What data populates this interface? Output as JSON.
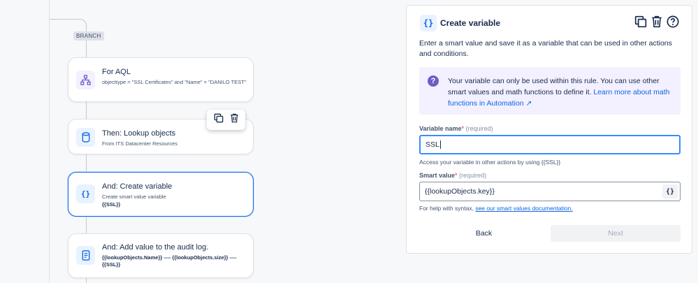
{
  "branch": {
    "tag": "BRANCH"
  },
  "cards": [
    {
      "title": "For AQL",
      "subtitle": "objecttype = \"SSL Certificates\" and \"Name\" = \"DANILO TEST\"",
      "icon": "hierarchy-icon"
    },
    {
      "title": "Then: Lookup objects",
      "subtitle": "From ITS Datacenter Resources",
      "icon": "database-icon"
    },
    {
      "title": "And: Create variable",
      "subtitle": "Create smart value variable",
      "subtitle2": "{{SSL}}",
      "icon": "braces-icon"
    },
    {
      "title": "And: Add value to the audit log.",
      "subtitle": "{{lookupObjects.Name}} ---- {{lookupObjects.size}} ---- {{SSL}}",
      "icon": "document-icon"
    }
  ],
  "panel": {
    "icon_text": "{}",
    "title": "Create variable",
    "description": "Enter a smart value and save it as a variable that can be used in other actions and conditions.",
    "info": {
      "text": "Your variable can only be used within this rule. You can use other smart values and math functions to define it. ",
      "link": "Learn more about math functions in Automation ↗"
    },
    "variable_name": {
      "label": "Variable name",
      "required_mark": "*",
      "required_hint": "(required)",
      "value": "SSL",
      "helper": "Access your variable in other actions by using {{SSL}}"
    },
    "smart_value": {
      "label": "Smart value",
      "required_mark": "*",
      "required_hint": "(required)",
      "value": "{{lookupObjects.key}}",
      "button": "{}",
      "helper_prefix": "For help with syntax, ",
      "helper_link": "see our smart values documentation."
    },
    "back_label": "Back",
    "next_label": "Next"
  },
  "colors": {
    "accent": "#0c66e4",
    "info_bg": "#f3f0ff",
    "info_icon": "#6e5dc6"
  }
}
